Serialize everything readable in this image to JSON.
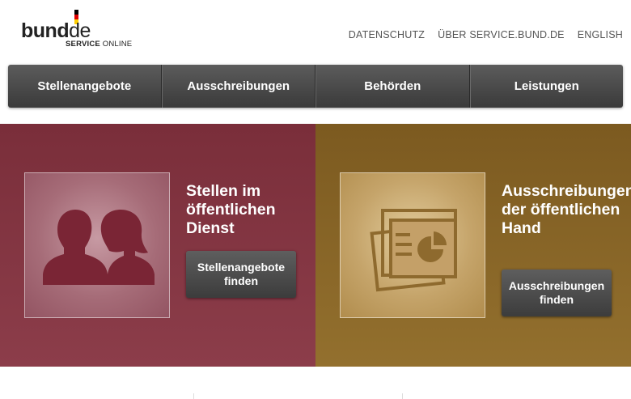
{
  "logo": {
    "part1": "bund",
    "part2": "de",
    "sub_bold": "SERVICE",
    "sub_light": " ONLINE",
    "flag_colors": [
      "#000000",
      "#dd0000",
      "#ffce00"
    ]
  },
  "toplinks": [
    {
      "label": "DATENSCHUTZ"
    },
    {
      "label": "ÜBER SERVICE.BUND.DE"
    },
    {
      "label": "ENGLISH"
    }
  ],
  "nav": [
    {
      "label": "Stellenangebote"
    },
    {
      "label": "Ausschreibungen"
    },
    {
      "label": "Behörden"
    },
    {
      "label": "Leistungen"
    }
  ],
  "tiles": {
    "jobs": {
      "title": "Stellen im öffentlichen Dienst",
      "button": "Stellenangebote finden",
      "icon": "people-icon",
      "color": "#8a3a47"
    },
    "tenders": {
      "title": "Ausschreibungen der öffentlichen Hand",
      "button": "Ausschreibungen finden",
      "icon": "documents-chart-icon",
      "color": "#8c6a2a"
    }
  }
}
